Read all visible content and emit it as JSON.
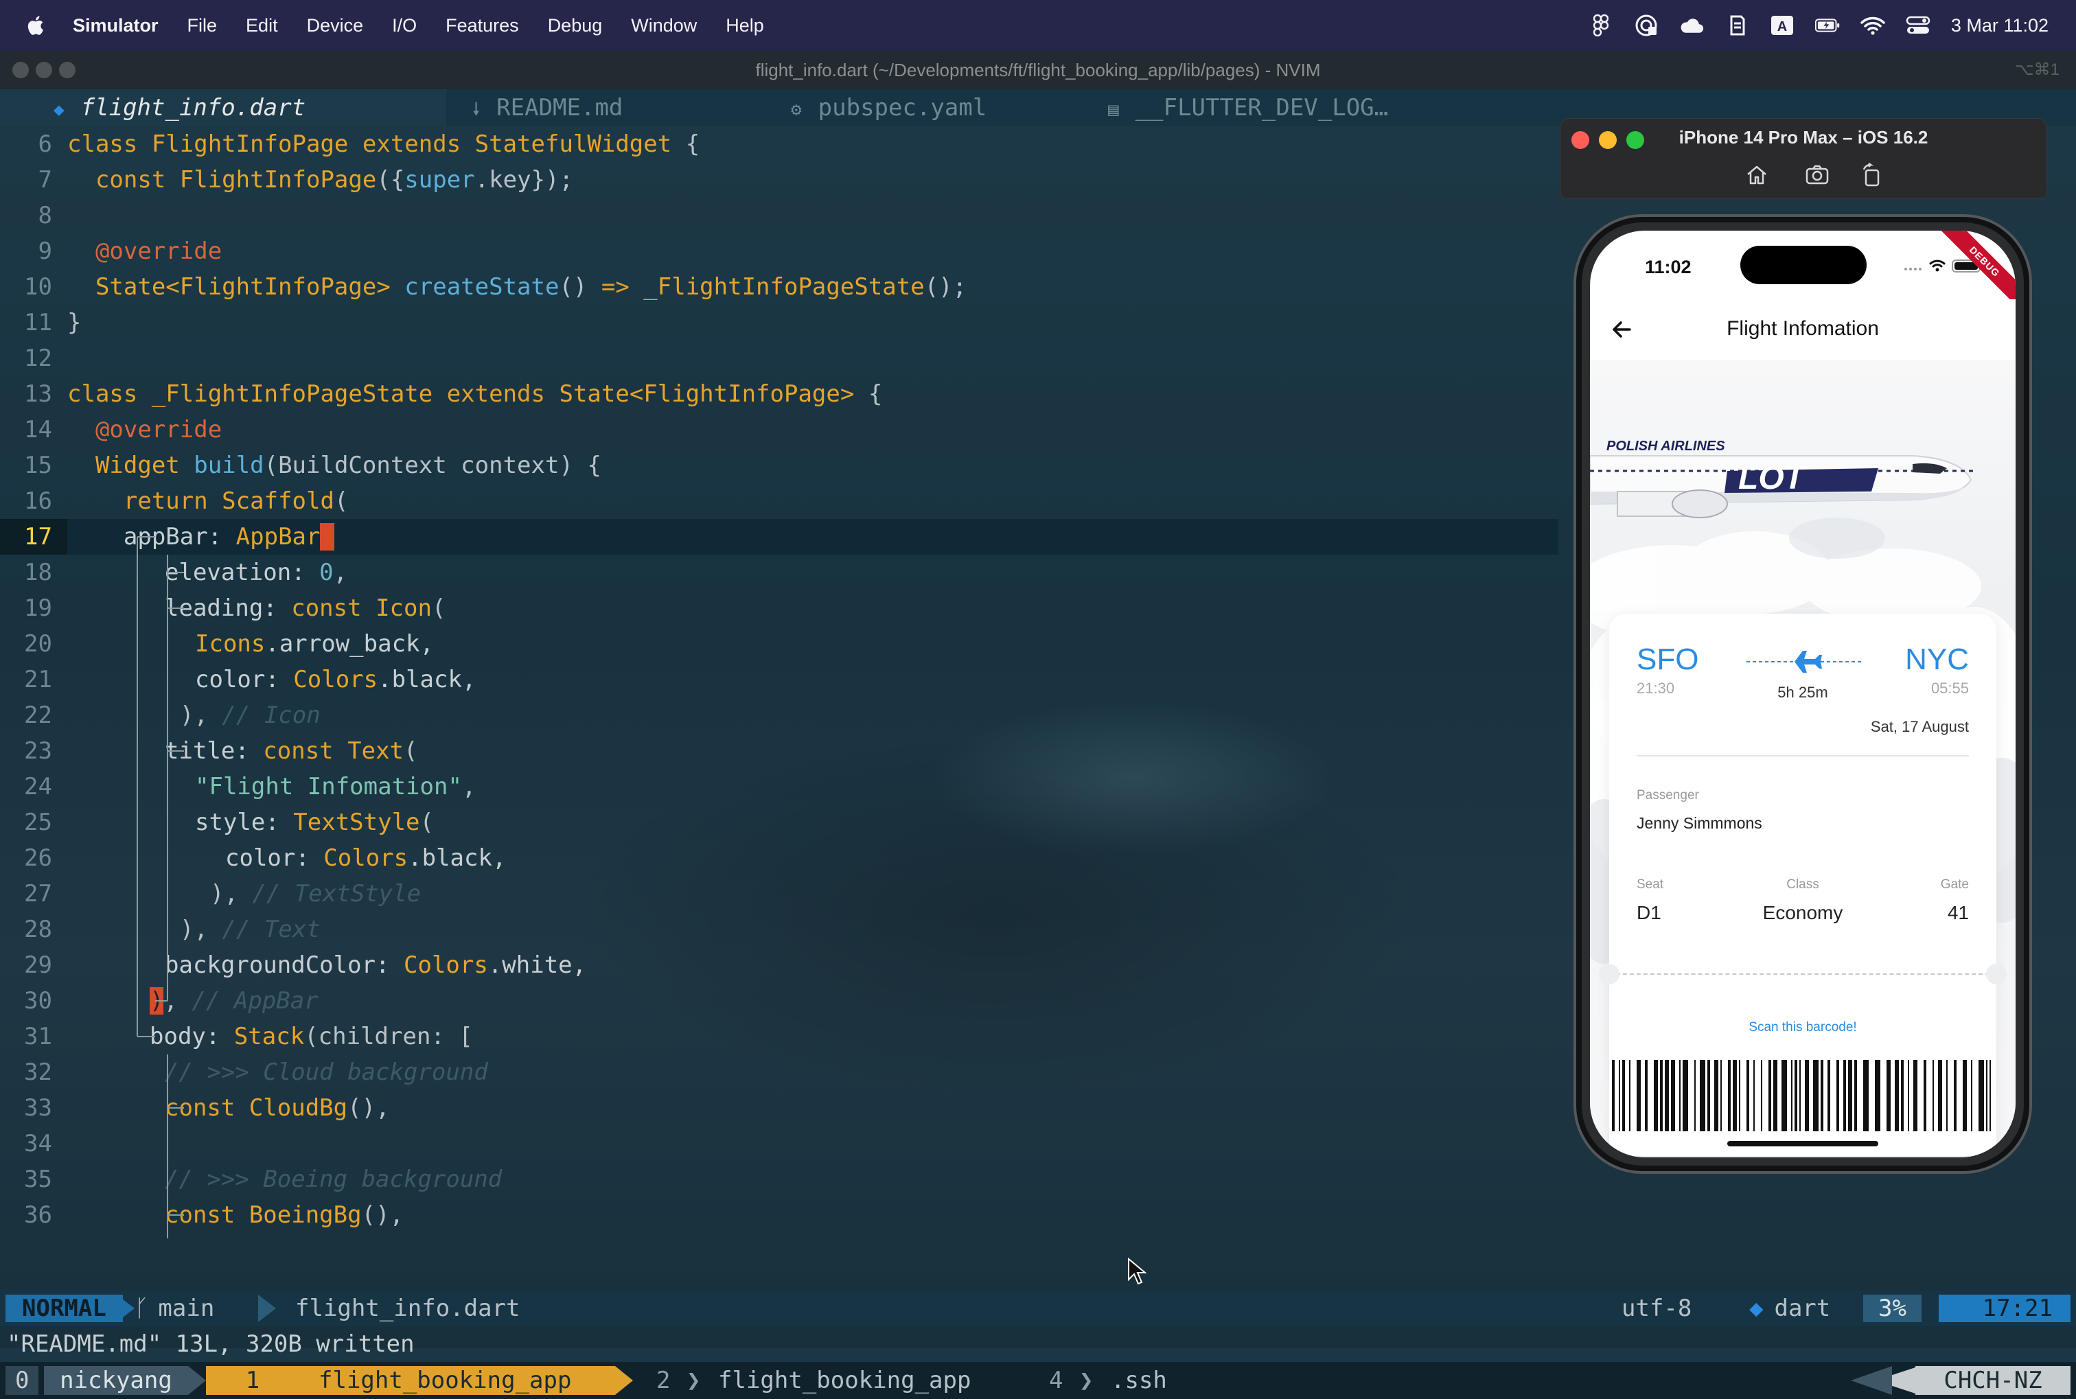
{
  "menubar": {
    "app": "Simulator",
    "items": [
      "File",
      "Edit",
      "Device",
      "I/O",
      "Features",
      "Debug",
      "Window",
      "Help"
    ],
    "clock": "3 Mar  11:02",
    "status_icons": [
      "figma-icon",
      "vpn-icon",
      "cloud-icon",
      "sync-icon",
      "input-source-icon",
      "battery-icon",
      "wifi-icon",
      "control-center-icon"
    ],
    "input_source": "A"
  },
  "terminal": {
    "title": "flight_info.dart (~/Developments/ft/flight_booking_app/lib/pages) - NVIM",
    "shortcut": "⌥⌘1",
    "tabs": [
      {
        "icon": "◆",
        "label": "flight_info.dart",
        "active": true
      },
      {
        "icon": "🠗",
        "label": "README.md",
        "active": false
      },
      {
        "icon": "⚙",
        "label": "pubspec.yaml",
        "active": false
      },
      {
        "icon": "▤",
        "label": "__FLUTTER_DEV_LOG…",
        "active": false
      }
    ]
  },
  "code": {
    "current_line": 17,
    "lines": [
      {
        "n": "6"
      },
      {
        "n": "7"
      },
      {
        "n": "8"
      },
      {
        "n": "9"
      },
      {
        "n": "10"
      },
      {
        "n": "11"
      },
      {
        "n": "12"
      },
      {
        "n": "13"
      },
      {
        "n": "14"
      },
      {
        "n": "15"
      },
      {
        "n": "16"
      },
      {
        "n": "17"
      },
      {
        "n": "18"
      },
      {
        "n": "19"
      },
      {
        "n": "20"
      },
      {
        "n": "21"
      },
      {
        "n": "22"
      },
      {
        "n": "23"
      },
      {
        "n": "24"
      },
      {
        "n": "25"
      },
      {
        "n": "26"
      },
      {
        "n": "27"
      },
      {
        "n": "28"
      },
      {
        "n": "29"
      },
      {
        "n": "30"
      },
      {
        "n": "31"
      },
      {
        "n": "32"
      },
      {
        "n": "33"
      },
      {
        "n": "34"
      },
      {
        "n": "35"
      },
      {
        "n": "36"
      }
    ],
    "text": {
      "l6": [
        "class",
        " FlightInfoPage ",
        "extends",
        " StatefulWidget",
        " {"
      ],
      "l7": [
        "  const",
        " FlightInfoPage",
        "({",
        "super",
        ".key});"
      ],
      "l9": [
        "  @override"
      ],
      "l10": [
        "  State<FlightInfoPage>",
        " createState",
        "()",
        " =>",
        " _FlightInfoPageState",
        "();"
      ],
      "l11": [
        "}"
      ],
      "l13": [
        "class",
        " _FlightInfoPageState ",
        "extends",
        " State<FlightInfoPage>",
        " {"
      ],
      "l14": [
        "  @override"
      ],
      "l15": [
        "  Widget",
        " build",
        "(BuildContext context) {"
      ],
      "l16": [
        "    return",
        " Scaffold",
        "("
      ],
      "l17": [
        "    ",
        "appBar: ",
        "AppBar",
        "("
      ],
      "l18": [
        "elevation: ",
        "0",
        ","
      ],
      "l19": [
        "leading: ",
        "const",
        " Icon",
        "("
      ],
      "l20": [
        "Icons",
        ".arrow_back,"
      ],
      "l21": [
        "color: ",
        "Colors",
        ".black,"
      ],
      "l22": [
        "), ",
        "// Icon"
      ],
      "l23": [
        "title: ",
        "const",
        " Text",
        "("
      ],
      "l24": [
        "\"Flight Infomation\"",
        ","
      ],
      "l25": [
        "style: ",
        "TextStyle",
        "("
      ],
      "l26": [
        "color: ",
        "Colors",
        ".black,"
      ],
      "l27": [
        "), ",
        "// TextStyle"
      ],
      "l28": [
        "), ",
        "// Text"
      ],
      "l29": [
        "backgroundColor: ",
        "Colors",
        ".white,"
      ],
      "l30": [
        ")",
        ", ",
        "// AppBar"
      ],
      "l31": [
        "body: ",
        "Stack",
        "(children: ["
      ],
      "l32": [
        "// >>> Cloud background"
      ],
      "l33": [
        "const",
        " CloudBg",
        "(),"
      ],
      "l35": [
        "// >>> Boeing background"
      ],
      "l36": [
        "const",
        " BoeingBg",
        "(),"
      ]
    }
  },
  "statusline": {
    "mode": "NORMAL",
    "branch": "main",
    "file": "flight_info.dart",
    "encoding": "utf-8",
    "filetype": "dart",
    "percent": "3%",
    "position": "17:21"
  },
  "cmdline": "\"README.md\" 13L, 320B written",
  "tmux": {
    "session_index": "0",
    "user": "nickyang",
    "windows": [
      {
        "index": "1",
        "name": "flight_booking_app",
        "active": true
      },
      {
        "index": "2",
        "name": "flight_booking_app",
        "active": false
      },
      {
        "index": "4",
        "name": ".ssh",
        "active": false
      }
    ],
    "host": "CHCH-NZ"
  },
  "simulator": {
    "title": "iPhone 14 Pro Max – iOS 16.2",
    "toolbar_buttons": [
      "home-icon",
      "screenshot-icon",
      "rotate-icon"
    ]
  },
  "phone": {
    "status_time": "11:02",
    "debug_banner": "DEBUG",
    "appbar_title": "Flight Infomation",
    "airline_livery": "POLISH AIRLINES",
    "airline_logo": "LOT",
    "from_code": "SFO",
    "from_time": "21:30",
    "to_code": "NYC",
    "to_time": "05:55",
    "duration": "5h 25m",
    "date": "Sat, 17 August",
    "passenger_label": "Passenger",
    "passenger_name": "Jenny Simmmons",
    "seat_label": "Seat",
    "seat_value": "D1",
    "class_label": "Class",
    "class_value": "Economy",
    "gate_label": "Gate",
    "gate_value": "41",
    "scan_text": "Scan this barcode!",
    "accent": "#2a8be0"
  }
}
